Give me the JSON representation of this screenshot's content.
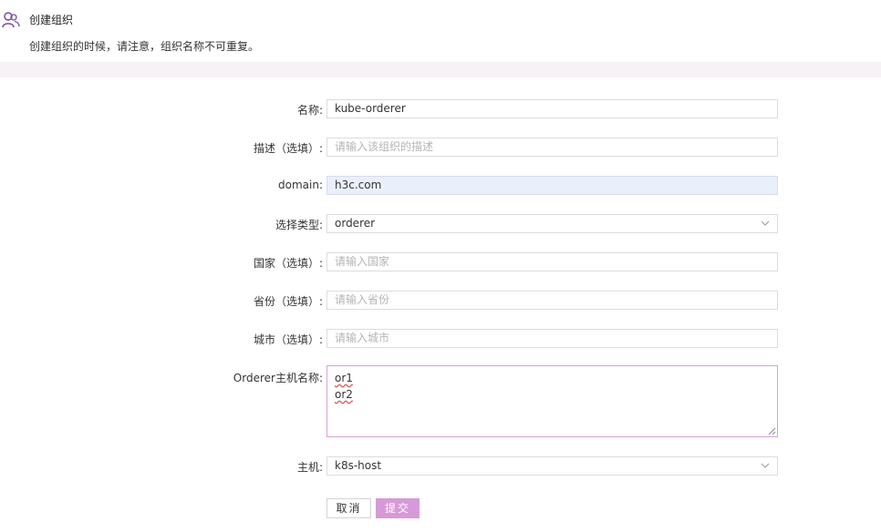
{
  "header": {
    "title": "创建组织",
    "description": "创建组织的时候，请注意，组织名称不可重复。",
    "icon": "users-icon"
  },
  "form": {
    "name": {
      "label": "名称:",
      "value": "kube-orderer"
    },
    "description": {
      "label": "描述（选填）:",
      "placeholder": "请输入该组织的描述"
    },
    "domain": {
      "label": "domain:",
      "value": "h3c.com"
    },
    "type": {
      "label": "选择类型:",
      "value": "orderer"
    },
    "country": {
      "label": "国家（选填）:",
      "placeholder": "请输入国家"
    },
    "province": {
      "label": "省份（选填）:",
      "placeholder": "请输入省份"
    },
    "city": {
      "label": "城市（选填）:",
      "placeholder": "请输入城市"
    },
    "orderer_hosts": {
      "label": "Orderer主机名称:",
      "lines": [
        "or1",
        "or2"
      ]
    },
    "host": {
      "label": "主机:",
      "value": "k8s-host"
    }
  },
  "actions": {
    "cancel_label": "取消",
    "submit_label": "提交"
  },
  "colors": {
    "accent": "#d79ad8",
    "band": "#f6f2f6",
    "autofill": "#eaf0fb"
  }
}
